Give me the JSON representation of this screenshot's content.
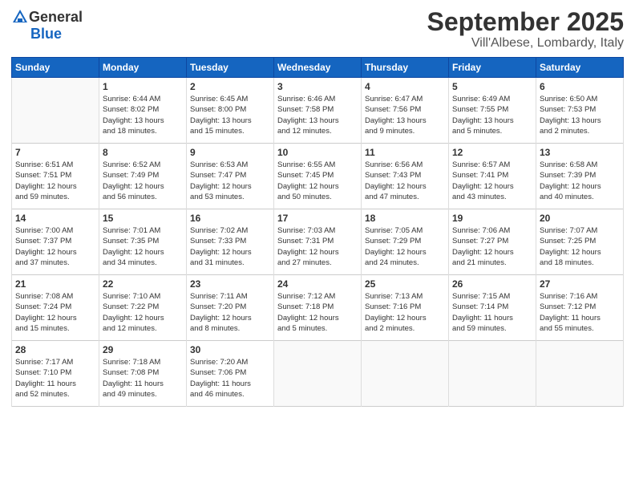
{
  "header": {
    "logo_general": "General",
    "logo_blue": "Blue",
    "title": "September 2025",
    "subtitle": "Vill'Albese, Lombardy, Italy"
  },
  "days_of_week": [
    "Sunday",
    "Monday",
    "Tuesday",
    "Wednesday",
    "Thursday",
    "Friday",
    "Saturday"
  ],
  "weeks": [
    [
      {
        "day": "",
        "detail": ""
      },
      {
        "day": "1",
        "detail": "Sunrise: 6:44 AM\nSunset: 8:02 PM\nDaylight: 13 hours\nand 18 minutes."
      },
      {
        "day": "2",
        "detail": "Sunrise: 6:45 AM\nSunset: 8:00 PM\nDaylight: 13 hours\nand 15 minutes."
      },
      {
        "day": "3",
        "detail": "Sunrise: 6:46 AM\nSunset: 7:58 PM\nDaylight: 13 hours\nand 12 minutes."
      },
      {
        "day": "4",
        "detail": "Sunrise: 6:47 AM\nSunset: 7:56 PM\nDaylight: 13 hours\nand 9 minutes."
      },
      {
        "day": "5",
        "detail": "Sunrise: 6:49 AM\nSunset: 7:55 PM\nDaylight: 13 hours\nand 5 minutes."
      },
      {
        "day": "6",
        "detail": "Sunrise: 6:50 AM\nSunset: 7:53 PM\nDaylight: 13 hours\nand 2 minutes."
      }
    ],
    [
      {
        "day": "7",
        "detail": "Sunrise: 6:51 AM\nSunset: 7:51 PM\nDaylight: 12 hours\nand 59 minutes."
      },
      {
        "day": "8",
        "detail": "Sunrise: 6:52 AM\nSunset: 7:49 PM\nDaylight: 12 hours\nand 56 minutes."
      },
      {
        "day": "9",
        "detail": "Sunrise: 6:53 AM\nSunset: 7:47 PM\nDaylight: 12 hours\nand 53 minutes."
      },
      {
        "day": "10",
        "detail": "Sunrise: 6:55 AM\nSunset: 7:45 PM\nDaylight: 12 hours\nand 50 minutes."
      },
      {
        "day": "11",
        "detail": "Sunrise: 6:56 AM\nSunset: 7:43 PM\nDaylight: 12 hours\nand 47 minutes."
      },
      {
        "day": "12",
        "detail": "Sunrise: 6:57 AM\nSunset: 7:41 PM\nDaylight: 12 hours\nand 43 minutes."
      },
      {
        "day": "13",
        "detail": "Sunrise: 6:58 AM\nSunset: 7:39 PM\nDaylight: 12 hours\nand 40 minutes."
      }
    ],
    [
      {
        "day": "14",
        "detail": "Sunrise: 7:00 AM\nSunset: 7:37 PM\nDaylight: 12 hours\nand 37 minutes."
      },
      {
        "day": "15",
        "detail": "Sunrise: 7:01 AM\nSunset: 7:35 PM\nDaylight: 12 hours\nand 34 minutes."
      },
      {
        "day": "16",
        "detail": "Sunrise: 7:02 AM\nSunset: 7:33 PM\nDaylight: 12 hours\nand 31 minutes."
      },
      {
        "day": "17",
        "detail": "Sunrise: 7:03 AM\nSunset: 7:31 PM\nDaylight: 12 hours\nand 27 minutes."
      },
      {
        "day": "18",
        "detail": "Sunrise: 7:05 AM\nSunset: 7:29 PM\nDaylight: 12 hours\nand 24 minutes."
      },
      {
        "day": "19",
        "detail": "Sunrise: 7:06 AM\nSunset: 7:27 PM\nDaylight: 12 hours\nand 21 minutes."
      },
      {
        "day": "20",
        "detail": "Sunrise: 7:07 AM\nSunset: 7:25 PM\nDaylight: 12 hours\nand 18 minutes."
      }
    ],
    [
      {
        "day": "21",
        "detail": "Sunrise: 7:08 AM\nSunset: 7:24 PM\nDaylight: 12 hours\nand 15 minutes."
      },
      {
        "day": "22",
        "detail": "Sunrise: 7:10 AM\nSunset: 7:22 PM\nDaylight: 12 hours\nand 12 minutes."
      },
      {
        "day": "23",
        "detail": "Sunrise: 7:11 AM\nSunset: 7:20 PM\nDaylight: 12 hours\nand 8 minutes."
      },
      {
        "day": "24",
        "detail": "Sunrise: 7:12 AM\nSunset: 7:18 PM\nDaylight: 12 hours\nand 5 minutes."
      },
      {
        "day": "25",
        "detail": "Sunrise: 7:13 AM\nSunset: 7:16 PM\nDaylight: 12 hours\nand 2 minutes."
      },
      {
        "day": "26",
        "detail": "Sunrise: 7:15 AM\nSunset: 7:14 PM\nDaylight: 11 hours\nand 59 minutes."
      },
      {
        "day": "27",
        "detail": "Sunrise: 7:16 AM\nSunset: 7:12 PM\nDaylight: 11 hours\nand 55 minutes."
      }
    ],
    [
      {
        "day": "28",
        "detail": "Sunrise: 7:17 AM\nSunset: 7:10 PM\nDaylight: 11 hours\nand 52 minutes."
      },
      {
        "day": "29",
        "detail": "Sunrise: 7:18 AM\nSunset: 7:08 PM\nDaylight: 11 hours\nand 49 minutes."
      },
      {
        "day": "30",
        "detail": "Sunrise: 7:20 AM\nSunset: 7:06 PM\nDaylight: 11 hours\nand 46 minutes."
      },
      {
        "day": "",
        "detail": ""
      },
      {
        "day": "",
        "detail": ""
      },
      {
        "day": "",
        "detail": ""
      },
      {
        "day": "",
        "detail": ""
      }
    ]
  ]
}
